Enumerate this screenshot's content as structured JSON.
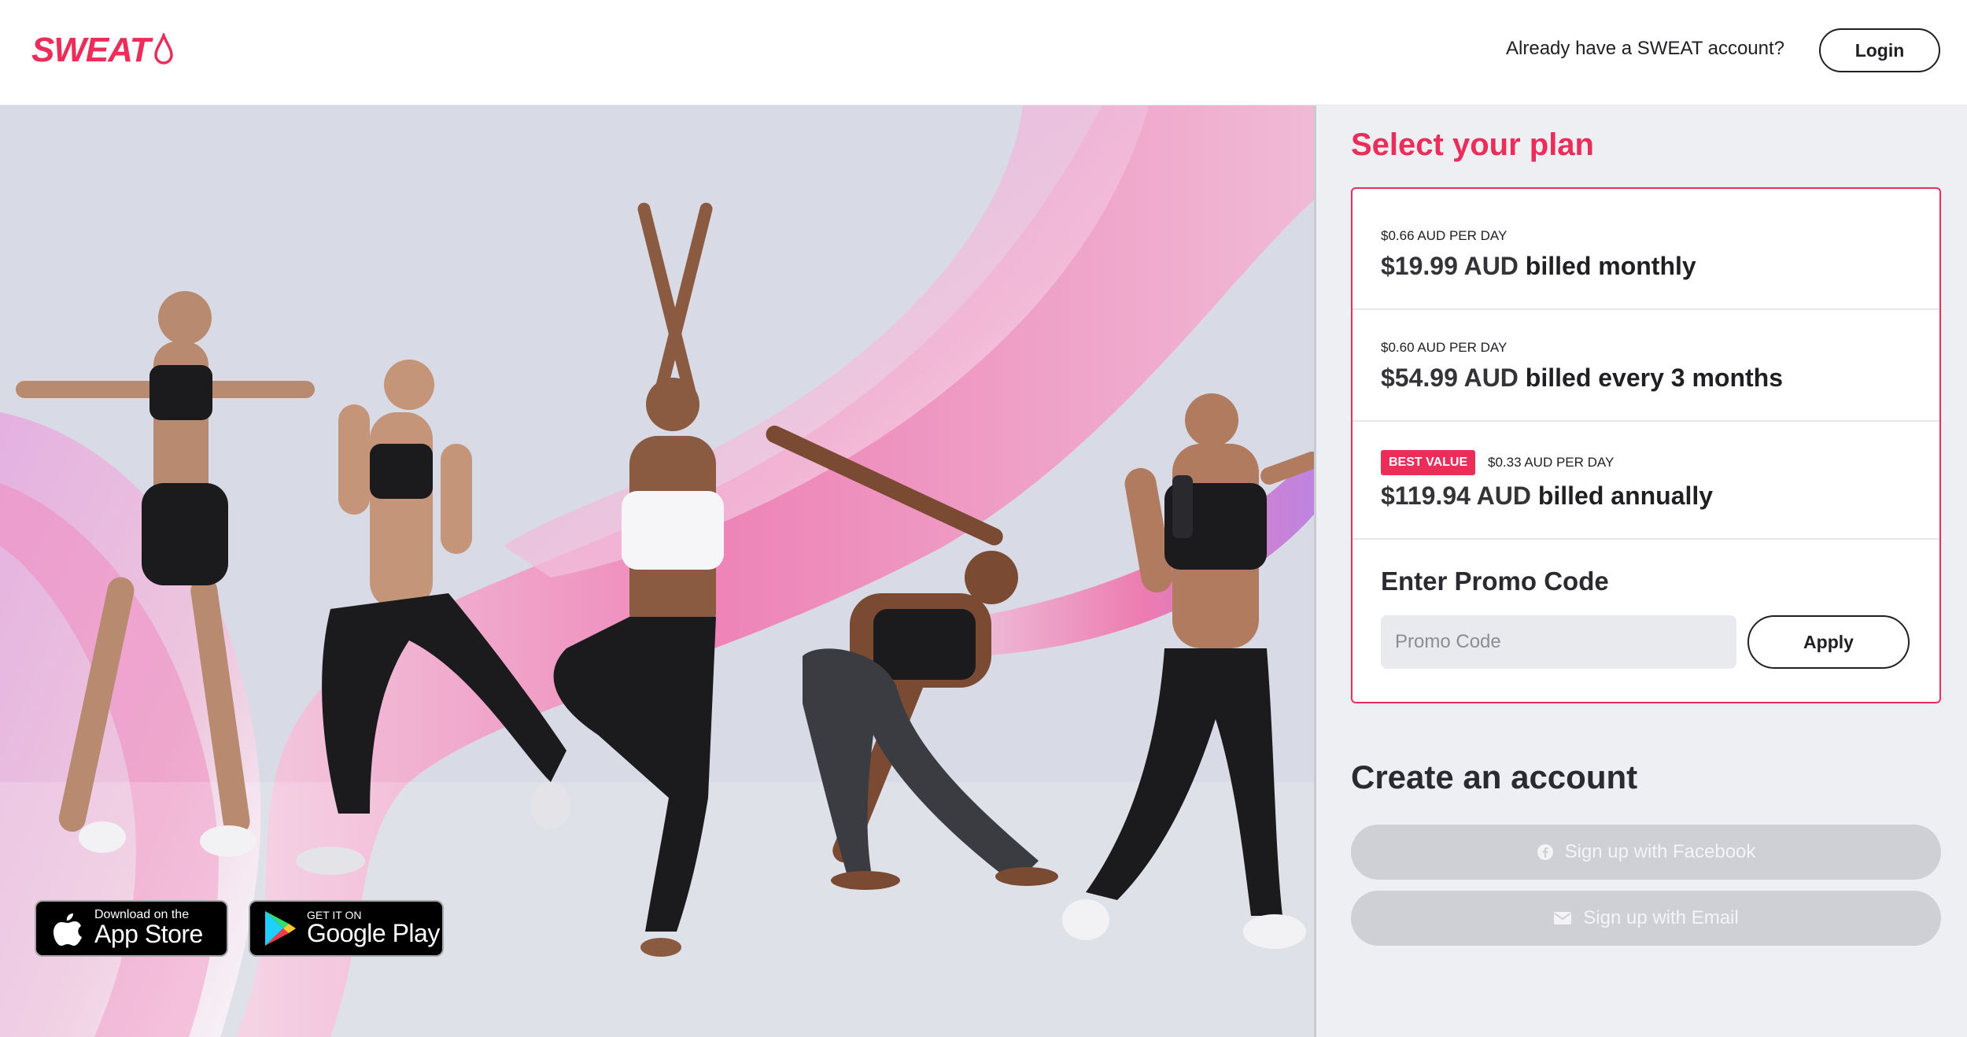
{
  "header": {
    "logo_text": "SWEAT",
    "account_question": "Already have a SWEAT account?",
    "login_label": "Login"
  },
  "hero": {
    "app_store": {
      "small": "Download on the",
      "big": "App Store"
    },
    "google_play": {
      "small": "GET IT ON",
      "big": "Google Play"
    }
  },
  "plans": {
    "title": "Select your plan",
    "items": [
      {
        "per_day": "$0.66 AUD PER DAY",
        "amount": "$19.99 AUD",
        "billing": "billed monthly",
        "badge": ""
      },
      {
        "per_day": "$0.60 AUD PER DAY",
        "amount": "$54.99 AUD",
        "billing": "billed every 3 months",
        "badge": ""
      },
      {
        "per_day": "$0.33 AUD PER DAY",
        "amount": "$119.94 AUD",
        "billing": "billed annually",
        "badge": "BEST VALUE"
      }
    ],
    "promo_title": "Enter Promo Code",
    "promo_placeholder": "Promo Code",
    "apply_label": "Apply"
  },
  "create": {
    "title": "Create an account",
    "facebook_label": "Sign up with Facebook",
    "email_label": "Sign up with Email"
  },
  "colors": {
    "brand": "#ea2d59",
    "panel_bg": "#eeeff3",
    "button_disabled": "#cfd0d6"
  },
  "icons": [
    "sweat-drop-icon",
    "apple-icon",
    "google-play-icon",
    "facebook-icon",
    "envelope-icon"
  ]
}
